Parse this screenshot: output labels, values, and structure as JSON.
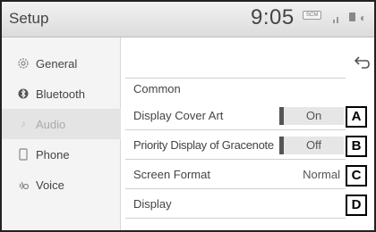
{
  "header": {
    "title": "Setup",
    "time": "9:05",
    "badge": "SCM"
  },
  "nav": {
    "items": [
      {
        "label": "General",
        "icon": "gear-icon"
      },
      {
        "label": "Bluetooth",
        "icon": "bluetooth-icon"
      },
      {
        "label": "Audio",
        "icon": "music-note-icon",
        "active": true
      },
      {
        "label": "Phone",
        "icon": "phone-icon"
      },
      {
        "label": "Voice",
        "icon": "voice-icon"
      }
    ],
    "more_icon": "chevron-down-icon"
  },
  "main": {
    "section_label": "Common",
    "back_icon": "back-arrow-icon",
    "rows": [
      {
        "label": "Display Cover Art",
        "toggle": "On",
        "callout": "A"
      },
      {
        "label": "Priority Display of Gracenote",
        "toggle": "Off",
        "callout": "B"
      },
      {
        "label": "Screen Format",
        "value": "Normal",
        "callout": "C"
      },
      {
        "label": "Display",
        "callout": "D"
      }
    ]
  }
}
